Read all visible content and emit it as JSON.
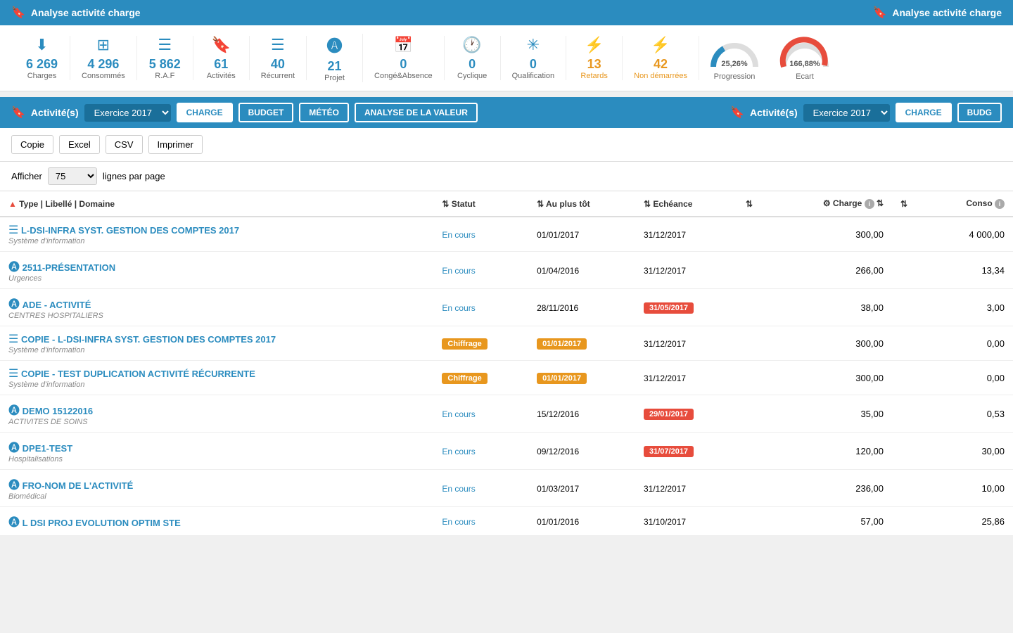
{
  "app": {
    "title": "Analyse activité charge",
    "title_right": "Analyse activité charge"
  },
  "stats": [
    {
      "id": "charges",
      "icon": "⬇",
      "number": "6 269",
      "label": "Charges",
      "color": "blue"
    },
    {
      "id": "consommes",
      "icon": "⊞",
      "number": "4 296",
      "label": "Consommés",
      "color": "blue"
    },
    {
      "id": "raf",
      "icon": "☰",
      "number": "5 862",
      "label": "R.A.F",
      "color": "blue"
    },
    {
      "id": "activites",
      "icon": "🔖",
      "number": "61",
      "label": "Activités",
      "color": "blue"
    },
    {
      "id": "recurrent",
      "icon": "☰",
      "number": "40",
      "label": "Récurrent",
      "color": "blue"
    },
    {
      "id": "projet",
      "icon": "A",
      "number": "21",
      "label": "Projet",
      "color": "blue"
    },
    {
      "id": "conge",
      "icon": "📅",
      "number": "0",
      "label": "Congé&Absence",
      "color": "blue"
    },
    {
      "id": "cyclique",
      "icon": "🕐",
      "number": "0",
      "label": "Cyclique",
      "color": "blue"
    },
    {
      "id": "qualification",
      "icon": "✳",
      "number": "0",
      "label": "Qualification",
      "color": "blue"
    },
    {
      "id": "retards",
      "icon": "⚡",
      "number": "13",
      "label": "Retards",
      "color": "orange"
    },
    {
      "id": "non-demarrees",
      "icon": "⚡",
      "number": "42",
      "label": "Non démarrées",
      "color": "orange"
    }
  ],
  "progression": {
    "value": "25,26%",
    "label": "Progression"
  },
  "ecart": {
    "value": "166,88%",
    "label": "Ecart"
  },
  "nav": {
    "title": "Activité(s)",
    "exercice": "Exercice 2017",
    "buttons": [
      "CHARGE",
      "BUDGET",
      "MÉTÉO",
      "ANALYSE DE LA VALEUR"
    ],
    "active_button": "CHARGE",
    "right_title": "Activité(s)",
    "right_exercice": "Exercice 2017",
    "right_buttons": [
      "CHARGE",
      "BUDG"
    ]
  },
  "toolbar": {
    "buttons": [
      "Copie",
      "Excel",
      "CSV",
      "Imprimer"
    ],
    "afficher_label": "Afficher",
    "afficher_value": "75",
    "afficher_suffix": "lignes par page"
  },
  "table": {
    "columns": [
      {
        "id": "type",
        "label": "▲ Type | Libellé | Domaine",
        "sortable": true
      },
      {
        "id": "statut",
        "label": "Statut",
        "sortable": true
      },
      {
        "id": "au-plus-tot",
        "label": "Au plus tôt",
        "sortable": true
      },
      {
        "id": "echeance",
        "label": "Echéance",
        "sortable": true
      },
      {
        "id": "empty",
        "label": "",
        "sortable": true
      },
      {
        "id": "charge",
        "label": "Charge",
        "sortable": true,
        "has_gear": true,
        "has_info": true
      },
      {
        "id": "empty2",
        "label": "",
        "sortable": true
      },
      {
        "id": "conso",
        "label": "Conso",
        "has_info": true
      }
    ],
    "rows": [
      {
        "icon": "list",
        "name": "L-DSI-INFRA SYST. GESTION DES COMPTES 2017",
        "domain": "Système d'information",
        "statut": "En cours",
        "statut_type": "normal",
        "au_plus_tot": "01/01/2017",
        "au_plus_tot_type": "normal",
        "echeance": "31/12/2017",
        "echeance_type": "normal",
        "charge": "300,00",
        "conso": "4 000,00"
      },
      {
        "icon": "project",
        "name": "2511-PRÉSENTATION",
        "domain": "Urgences",
        "statut": "En cours",
        "statut_type": "normal",
        "au_plus_tot": "01/04/2016",
        "au_plus_tot_type": "normal",
        "echeance": "31/12/2017",
        "echeance_type": "normal",
        "charge": "266,00",
        "conso": "13,34"
      },
      {
        "icon": "project",
        "name": "ADE - ACTIVITÉ",
        "domain": "CENTRES HOSPITALIERS",
        "statut": "En cours",
        "statut_type": "normal",
        "au_plus_tot": "28/11/2016",
        "au_plus_tot_type": "normal",
        "echeance": "31/05/2017",
        "echeance_type": "red",
        "charge": "38,00",
        "conso": "3,00"
      },
      {
        "icon": "list",
        "name": "COPIE - L-DSI-INFRA SYST. GESTION DES COMPTES 2017",
        "domain": "Système d'information",
        "statut": "Chiffrage",
        "statut_type": "chiffrage",
        "au_plus_tot": "01/01/2017",
        "au_plus_tot_type": "orange",
        "echeance": "31/12/2017",
        "echeance_type": "normal",
        "charge": "300,00",
        "conso": "0,00"
      },
      {
        "icon": "list",
        "name": "COPIE - TEST DUPLICATION ACTIVITÉ RÉCURRENTE",
        "domain": "Système d'information",
        "statut": "Chiffrage",
        "statut_type": "chiffrage",
        "au_plus_tot": "01/01/2017",
        "au_plus_tot_type": "orange",
        "echeance": "31/12/2017",
        "echeance_type": "normal",
        "charge": "300,00",
        "conso": "0,00"
      },
      {
        "icon": "project",
        "name": "DEMO 15122016",
        "domain": "ACTIVITES DE SOINS",
        "statut": "En cours",
        "statut_type": "normal",
        "au_plus_tot": "15/12/2016",
        "au_plus_tot_type": "normal",
        "echeance": "29/01/2017",
        "echeance_type": "red",
        "charge": "35,00",
        "conso": "0,53"
      },
      {
        "icon": "project",
        "name": "DPE1-TEST",
        "domain": "Hospitalisations",
        "statut": "En cours",
        "statut_type": "normal",
        "au_plus_tot": "09/12/2016",
        "au_plus_tot_type": "normal",
        "echeance": "31/07/2017",
        "echeance_type": "red",
        "charge": "120,00",
        "conso": "30,00"
      },
      {
        "icon": "project",
        "name": "FRO-NOM DE L'ACTIVITÉ",
        "domain": "Biomédical",
        "statut": "En cours",
        "statut_type": "normal",
        "au_plus_tot": "01/03/2017",
        "au_plus_tot_type": "normal",
        "echeance": "31/12/2017",
        "echeance_type": "normal",
        "charge": "236,00",
        "conso": "10,00"
      },
      {
        "icon": "project",
        "name": "L DSI PROJ EVOLUTION OPTIM STE",
        "domain": "",
        "statut": "En cours",
        "statut_type": "normal",
        "au_plus_tot": "01/01/2016",
        "au_plus_tot_type": "normal",
        "echeance": "31/10/2017",
        "echeance_type": "normal",
        "charge": "57,00",
        "conso": "25,86"
      }
    ]
  }
}
